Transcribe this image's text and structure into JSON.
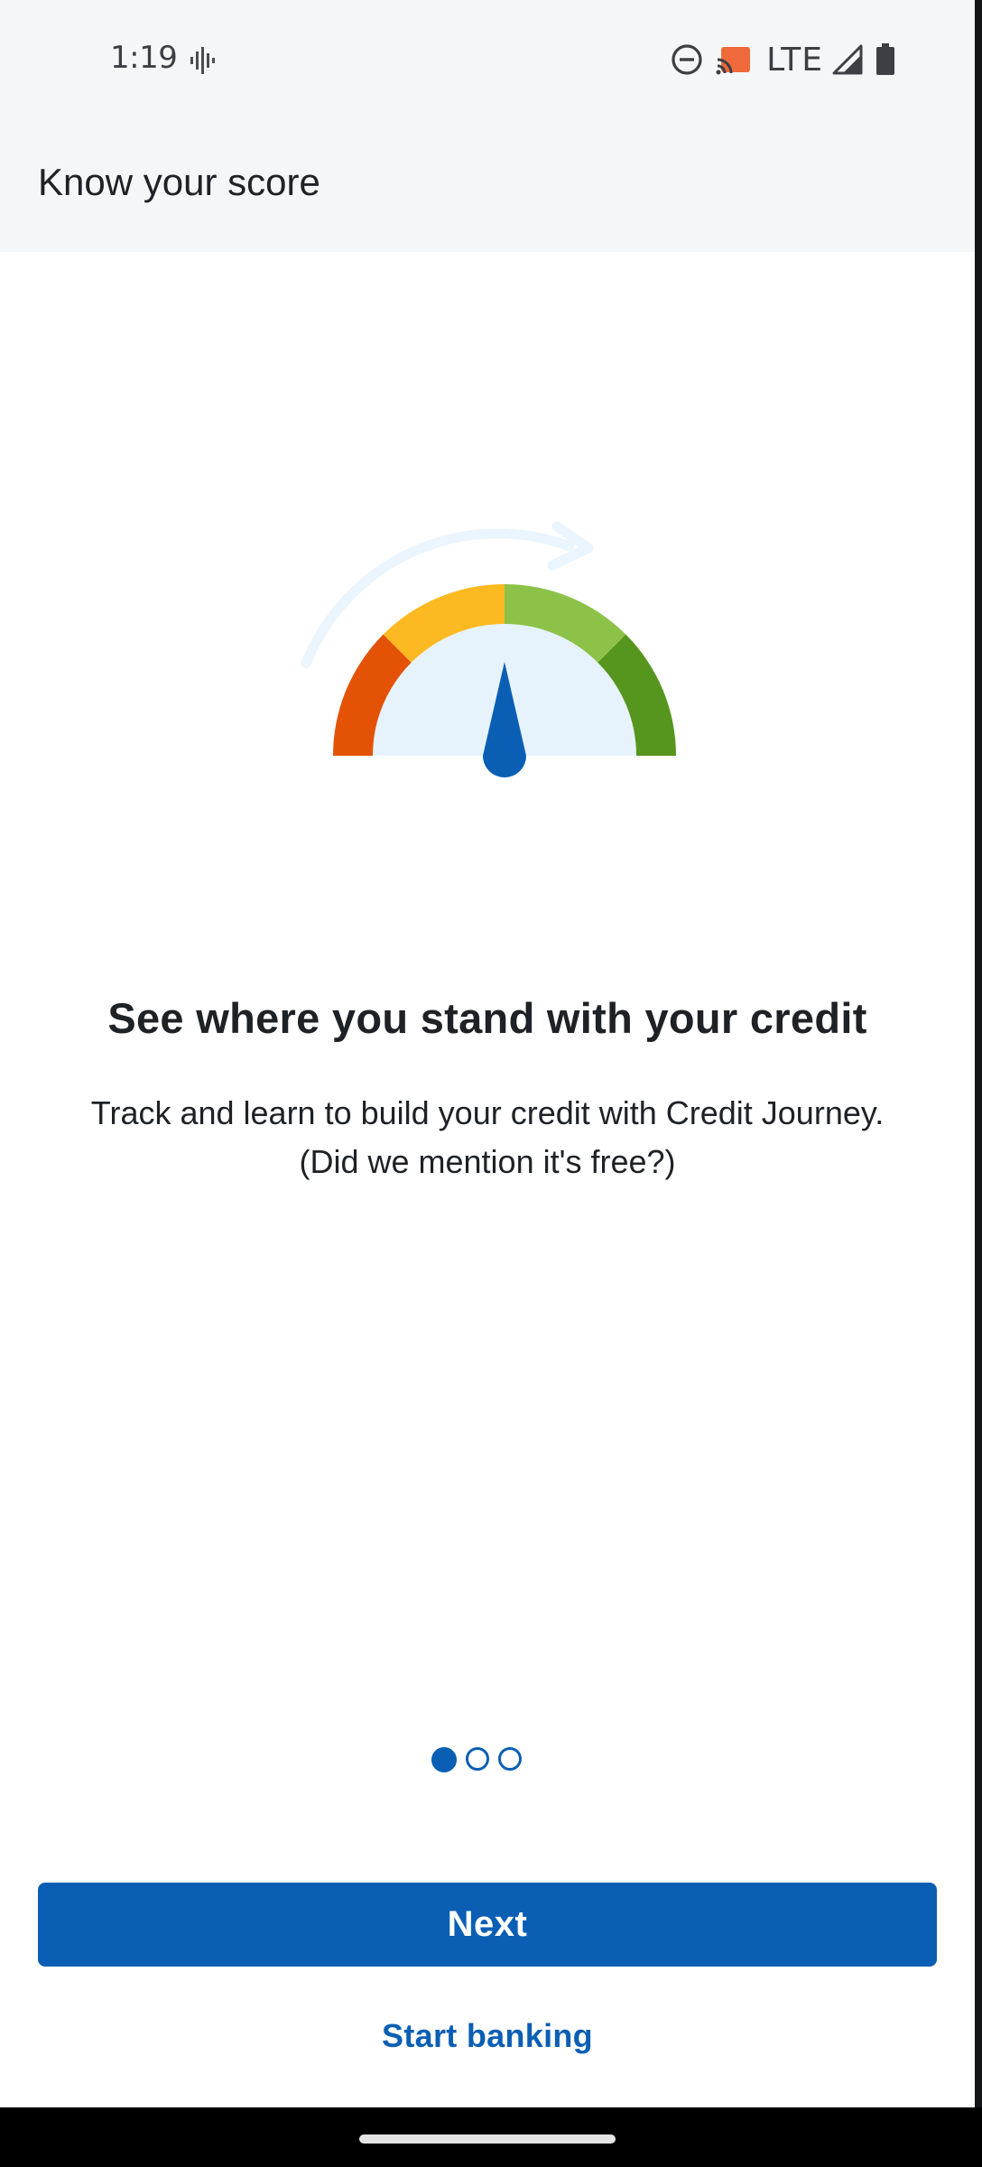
{
  "status_bar": {
    "time": "1:19",
    "network": "LTE",
    "icons": [
      "voicemail-icon",
      "do-not-disturb-icon",
      "cast-icon",
      "signal-icon",
      "battery-icon"
    ]
  },
  "header": {
    "title": "Know your score"
  },
  "illustration": {
    "icon": "credit-score-gauge",
    "colors": {
      "red": "#e35205",
      "yellow": "#fdb921",
      "light_green": "#8dc249",
      "dark_green": "#56961e",
      "needle": "#0a5fb4",
      "face": "#e7f3fc",
      "arrow": "#eaf5fd"
    }
  },
  "content": {
    "headline": "See where you stand with your credit",
    "body_line1": "Track and learn to build your credit with Credit Journey.",
    "body_line2": "(Did we mention it's free?)"
  },
  "pager": {
    "current_page": 1,
    "total_pages": 3
  },
  "actions": {
    "next_label": "Next",
    "start_banking_label": "Start banking"
  },
  "theme": {
    "accent": "#0a5fb4",
    "header_background": "#f5f6f8"
  }
}
